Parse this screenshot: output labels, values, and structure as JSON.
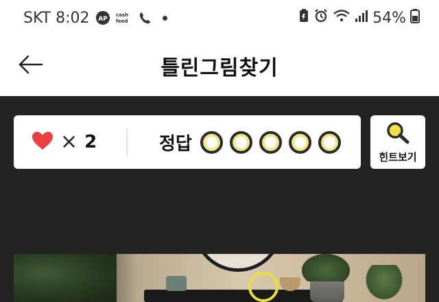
{
  "status_bar": {
    "carrier_time": "SKT 8:02",
    "battery": "54%",
    "app_icons": [
      "ap-app-icon",
      "cashfeed-icon",
      "call-who-icon"
    ],
    "right_icons": [
      "battery-saver-icon",
      "alarm-icon",
      "wifi-icon",
      "signal-icon",
      "battery-icon"
    ]
  },
  "header": {
    "title": "틀린그림찾기",
    "back_icon": "arrow-left-icon"
  },
  "game_status": {
    "lives_icon": "heart-icon",
    "lives_prefix": "×",
    "lives_count": "2",
    "answers_label": "정답",
    "answers_total": 5,
    "answers_found": 0
  },
  "hint": {
    "label": "힌트보기",
    "icon": "magnifier-icon"
  },
  "colors": {
    "background": "#232323",
    "heart": "#e8413f",
    "accent_yellow": "#e8e03c",
    "card": "#ffffff"
  },
  "puzzle": {
    "image": "interior-room-photo",
    "marks_found": 1
  }
}
